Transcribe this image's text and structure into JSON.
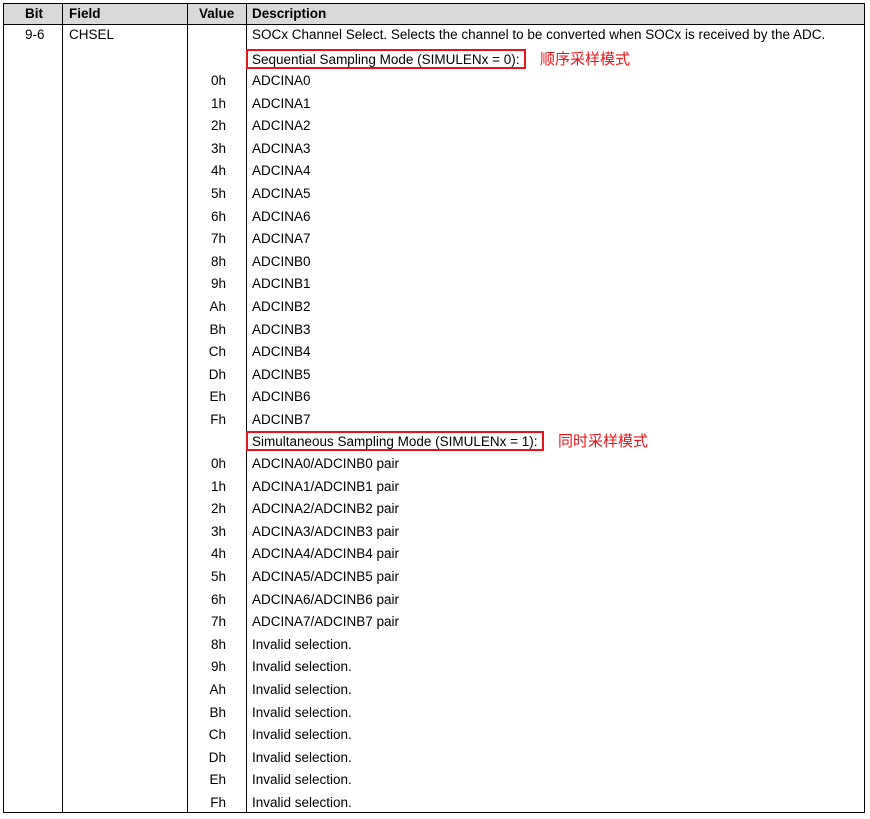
{
  "header": {
    "bit": "Bit",
    "field": "Field",
    "value": "Value",
    "description": "Description"
  },
  "row": {
    "bit": "9-6",
    "field": "CHSEL",
    "description": "SOCx Channel Select. Selects the channel to be converted when SOCx is received by the ADC."
  },
  "sequential": {
    "heading": "Sequential Sampling Mode (SIMULENx = 0):",
    "note": "顺序采样模式",
    "entries": [
      {
        "value": "0h",
        "desc": "ADCINA0"
      },
      {
        "value": "1h",
        "desc": "ADCINA1"
      },
      {
        "value": "2h",
        "desc": "ADCINA2"
      },
      {
        "value": "3h",
        "desc": "ADCINA3"
      },
      {
        "value": "4h",
        "desc": "ADCINA4"
      },
      {
        "value": "5h",
        "desc": "ADCINA5"
      },
      {
        "value": "6h",
        "desc": "ADCINA6"
      },
      {
        "value": "7h",
        "desc": "ADCINA7"
      },
      {
        "value": "8h",
        "desc": "ADCINB0"
      },
      {
        "value": "9h",
        "desc": "ADCINB1"
      },
      {
        "value": "Ah",
        "desc": "ADCINB2"
      },
      {
        "value": "Bh",
        "desc": "ADCINB3"
      },
      {
        "value": "Ch",
        "desc": "ADCINB4"
      },
      {
        "value": "Dh",
        "desc": "ADCINB5"
      },
      {
        "value": "Eh",
        "desc": "ADCINB6"
      },
      {
        "value": "Fh",
        "desc": "ADCINB7"
      }
    ]
  },
  "simultaneous": {
    "heading": "Simultaneous Sampling Mode (SIMULENx = 1):",
    "note": "同时采样模式",
    "entries": [
      {
        "value": "0h",
        "desc": "ADCINA0/ADCINB0 pair"
      },
      {
        "value": "1h",
        "desc": "ADCINA1/ADCINB1 pair"
      },
      {
        "value": "2h",
        "desc": "ADCINA2/ADCINB2 pair"
      },
      {
        "value": "3h",
        "desc": "ADCINA3/ADCINB3 pair"
      },
      {
        "value": "4h",
        "desc": "ADCINA4/ADCINB4 pair"
      },
      {
        "value": "5h",
        "desc": "ADCINA5/ADCINB5 pair"
      },
      {
        "value": "6h",
        "desc": "ADCINA6/ADCINB6 pair"
      },
      {
        "value": "7h",
        "desc": "ADCINA7/ADCINB7 pair"
      },
      {
        "value": "8h",
        "desc": "Invalid selection."
      },
      {
        "value": "9h",
        "desc": "Invalid selection."
      },
      {
        "value": "Ah",
        "desc": "Invalid selection."
      },
      {
        "value": "Bh",
        "desc": "Invalid selection."
      },
      {
        "value": "Ch",
        "desc": "Invalid selection."
      },
      {
        "value": "Dh",
        "desc": "Invalid selection."
      },
      {
        "value": "Eh",
        "desc": "Invalid selection."
      },
      {
        "value": "Fh",
        "desc": "Invalid selection."
      }
    ]
  },
  "colors": {
    "header_bg": "#d9d9d9",
    "highlight": "#e8141b"
  }
}
